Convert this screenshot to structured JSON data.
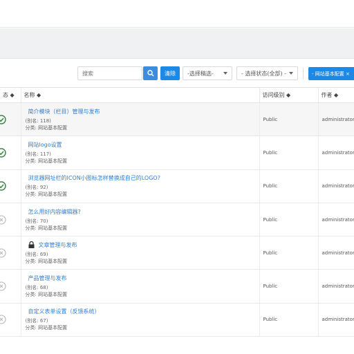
{
  "toolbar": {
    "search_placeholder": "搜索",
    "clear_label": "清除",
    "filter1_label": "-选择稿选-",
    "filter2_label": "- 选择状态(全部) -",
    "config_label": "- 网站基本配置 ×"
  },
  "table": {
    "headers": {
      "status": "态 ◆",
      "name": "名称 ◆",
      "access": "访问级别 ◆",
      "author": "作者 ◆"
    },
    "rows": [
      {
        "status": "published",
        "title": "简介模块（栏目）管理与发布",
        "alias": "(别名: 118)",
        "category": "分类: 网站基本配置",
        "access": "Public",
        "author": "administrator",
        "locked": false
      },
      {
        "status": "published",
        "title": "网站logo设置",
        "alias": "(别名: 117)",
        "category": "分类: 网站基本配置",
        "access": "Public",
        "author": "administrator",
        "locked": false
      },
      {
        "status": "published",
        "title": "浏览器网址栏的ICON小图标怎样替换成自己的LOGO?",
        "alias": "(别名: 92)",
        "category": "分类: 网站基本配置",
        "access": "Public",
        "author": "administrator",
        "locked": false
      },
      {
        "status": "unpublished",
        "title": "怎么用好内容编辑器?",
        "alias": "(别名: 70)",
        "category": "分类: 网站基本配置",
        "access": "Public",
        "author": "administrator",
        "locked": false
      },
      {
        "status": "unpublished",
        "title": "文章管理与发布",
        "alias": "(别名: 69)",
        "category": "分类: 网站基本配置",
        "access": "Public",
        "author": "administrator",
        "locked": true
      },
      {
        "status": "unpublished",
        "title": "产品管理与发布",
        "alias": "(别名: 68)",
        "category": "分类: 网站基本配置",
        "access": "Public",
        "author": "administrator",
        "locked": false
      },
      {
        "status": "unpublished",
        "title": "自定义表单设置（反馈系统）",
        "alias": "(别名: 67)",
        "category": "分类: 网站基本配置",
        "access": "Public",
        "author": "administrator",
        "locked": false
      }
    ]
  },
  "colors": {
    "accent": "#1e88e5",
    "published": "#2e8b3d",
    "unpublished": "#b0b0b0",
    "link": "#2f7fd1"
  },
  "icons": {
    "search": "search-icon",
    "published": "check-circle-icon",
    "unpublished": "x-circle-icon",
    "lock": "lock-icon"
  }
}
